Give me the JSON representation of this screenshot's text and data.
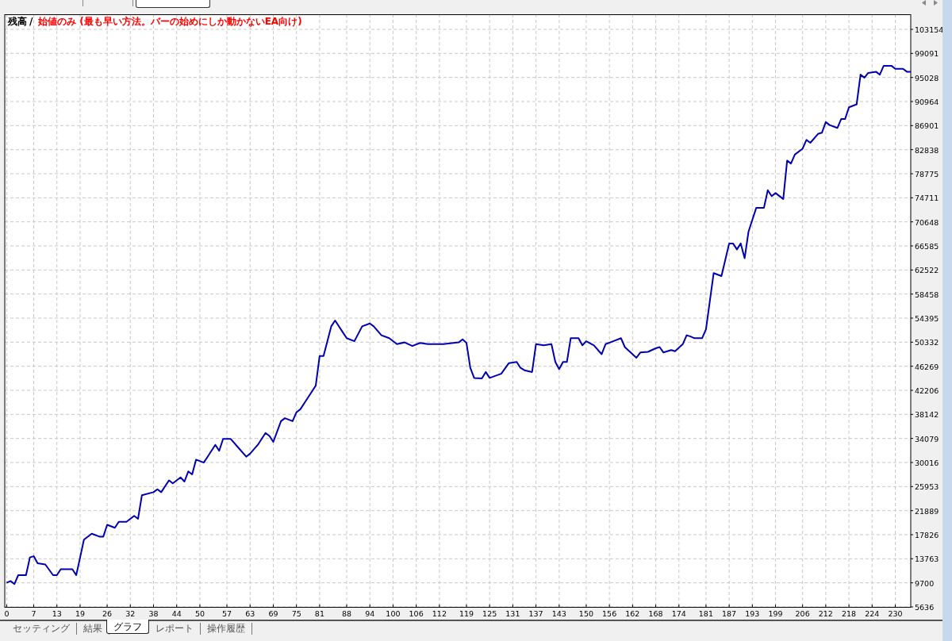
{
  "top_tabs": [
    {
      "selected": false
    },
    {
      "selected": false
    },
    {
      "selected": true
    }
  ],
  "chart": {
    "legend": {
      "separator": "/",
      "items": [
        {
          "kind": "series",
          "color": "#000000"
        },
        {
          "kind": "note",
          "text": "始値のみ (最も早い方法。バーの始めにしか動かないEA向け)",
          "color": "#ff0000"
        }
      ]
    },
    "chart_data": {
      "type": "line",
      "grid": true,
      "xlim": [
        -0.5,
        234
      ],
      "ylim": [
        5636,
        105700
      ],
      "xticks": [
        0,
        7,
        13,
        19,
        26,
        32,
        38,
        44,
        50,
        57,
        63,
        69,
        75,
        81,
        88,
        94,
        100,
        106,
        112,
        119,
        125,
        131,
        137,
        143,
        150,
        156,
        162,
        168,
        174,
        181,
        187,
        193,
        199,
        206,
        212,
        218,
        224,
        230
      ],
      "yticks": [
        5636,
        9700,
        13763,
        17826,
        21889,
        25953,
        30016,
        34079,
        38142,
        42206,
        46269,
        50332,
        54395,
        58458,
        62522,
        66585,
        70648,
        74711,
        78775,
        82838,
        86901,
        90964,
        95028,
        99091,
        103154
      ],
      "x": [
        0,
        1,
        2,
        3,
        5,
        6,
        7,
        8,
        10,
        12,
        13,
        14,
        17,
        18,
        19,
        20,
        22,
        24,
        25,
        26,
        28,
        29,
        31,
        33,
        34,
        35,
        38,
        39,
        40,
        42,
        43,
        45,
        46,
        47,
        48,
        49,
        51,
        52,
        54,
        55,
        56,
        58,
        60,
        62,
        63,
        65,
        67,
        68,
        69,
        71,
        72,
        74,
        75,
        76,
        77,
        79,
        80,
        81,
        82,
        84,
        85,
        87,
        88,
        90,
        92,
        94,
        95,
        97,
        99,
        101,
        103,
        105,
        107,
        109,
        113,
        117,
        118,
        119,
        120,
        121,
        123,
        124,
        125,
        128,
        130,
        132,
        133,
        134,
        136,
        137,
        139,
        141,
        142,
        143,
        144,
        145,
        146,
        148,
        149,
        150,
        152,
        154,
        155,
        157,
        159,
        160,
        163,
        164,
        166,
        168,
        169,
        170,
        172,
        173,
        175,
        176,
        177,
        178,
        180,
        181,
        183,
        185,
        187,
        188,
        189,
        190,
        191,
        192,
        194,
        196,
        197,
        198,
        199,
        201,
        202,
        203,
        204,
        206,
        207,
        208,
        210,
        211,
        212,
        213,
        215,
        216,
        217,
        218,
        220,
        221,
        222,
        223,
        225,
        226,
        227,
        229,
        230,
        232,
        233,
        234
      ],
      "series": [
        {
          "name": "残高",
          "color": "#0000b0",
          "values": [
            9700,
            10000,
            9500,
            11000,
            11000,
            14000,
            14200,
            13000,
            12800,
            11000,
            11000,
            12000,
            12000,
            11000,
            14000,
            17000,
            18000,
            17500,
            17500,
            19500,
            19000,
            20000,
            20000,
            21000,
            20500,
            24500,
            25000,
            25500,
            25000,
            27000,
            26500,
            27500,
            26800,
            28500,
            28000,
            30500,
            30000,
            31000,
            33000,
            32000,
            34000,
            34000,
            32500,
            31000,
            31500,
            33000,
            35000,
            34500,
            33500,
            37000,
            37500,
            37000,
            38500,
            39000,
            40000,
            42000,
            43000,
            48000,
            48000,
            53000,
            54000,
            52000,
            51000,
            50500,
            53000,
            53500,
            53000,
            51500,
            51000,
            50000,
            50300,
            49700,
            50200,
            50000,
            50000,
            50300,
            50800,
            50200,
            46000,
            44300,
            44200,
            45300,
            44300,
            45000,
            46800,
            47000,
            46000,
            45600,
            45300,
            50000,
            49800,
            50000,
            47000,
            45800,
            47000,
            47000,
            51000,
            51000,
            49800,
            50500,
            49800,
            48300,
            50000,
            50500,
            51000,
            49500,
            47700,
            48600,
            48700,
            49300,
            49500,
            48600,
            49000,
            48800,
            50000,
            51500,
            51300,
            51000,
            51000,
            52500,
            62000,
            61500,
            67000,
            67000,
            66000,
            67000,
            64500,
            69000,
            73000,
            73000,
            76000,
            75000,
            75500,
            74500,
            81000,
            80500,
            82000,
            83000,
            84500,
            84000,
            85500,
            85700,
            87500,
            87000,
            86500,
            88000,
            88000,
            90000,
            90500,
            95500,
            95000,
            95800,
            96000,
            95500,
            97000,
            97000,
            96500,
            96500,
            96000,
            96000
          ]
        }
      ]
    }
  },
  "bottom_tabs": [
    {
      "label": "セッティング",
      "selected": false
    },
    {
      "label": "結果",
      "selected": false
    },
    {
      "label": "グラフ",
      "selected": true
    },
    {
      "label": "レポート",
      "selected": false
    },
    {
      "label": "操作履歴",
      "selected": false
    }
  ]
}
